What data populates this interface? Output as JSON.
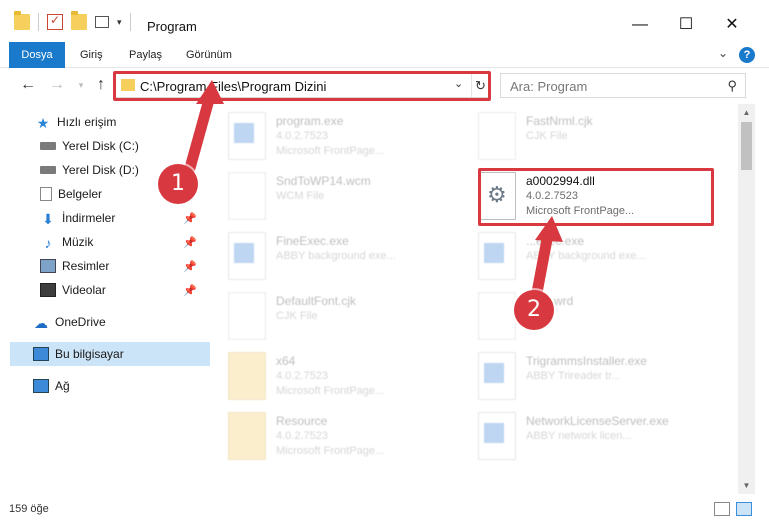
{
  "window": {
    "title": "Program",
    "controls": {
      "minimize": "—",
      "maximize": "☐",
      "close": "✕"
    }
  },
  "ribbon": {
    "tabs": [
      "Dosya",
      "Giriş",
      "Paylaş",
      "Görünüm"
    ],
    "expand_icon": "chevron-down-icon",
    "help_label": "?"
  },
  "nav": {
    "address": "C:\\Program Files\\Program Dizini",
    "search_placeholder": "Ara: Program",
    "back_glyph": "←",
    "forward_glyph": "→",
    "up_glyph": "↑",
    "refresh_glyph": "↻",
    "search_glyph": "⚲"
  },
  "sidebar": {
    "items": [
      {
        "label": "Hızlı erişim",
        "icon": "star-icon"
      },
      {
        "label": "Yerel Disk (C:)",
        "icon": "disk-icon"
      },
      {
        "label": "Yerel Disk (D:)",
        "icon": "disk-icon"
      },
      {
        "label": "Belgeler",
        "icon": "documents-icon"
      },
      {
        "label": "İndirmeler",
        "icon": "download-icon",
        "pinned": true
      },
      {
        "label": "Müzik",
        "icon": "music-icon",
        "pinned": true
      },
      {
        "label": "Resimler",
        "icon": "pictures-icon",
        "pinned": true
      },
      {
        "label": "Videolar",
        "icon": "video-icon",
        "pinned": true
      },
      {
        "label": "OneDrive",
        "icon": "cloud-icon"
      },
      {
        "label": "Bu bilgisayar",
        "icon": "computer-icon",
        "selected": true
      },
      {
        "label": "Ağ",
        "icon": "network-icon"
      }
    ]
  },
  "files": [
    {
      "name": "program.exe",
      "type": "4.0.2.7523",
      "desc": "Microsoft FrontPage...",
      "kind": "exe"
    },
    {
      "name": "FastNrml.cjk",
      "type": "CJK File",
      "desc": "",
      "kind": "page"
    },
    {
      "name": "SndToWP14.wcm",
      "type": "WCM File",
      "desc": "",
      "kind": "page"
    },
    {
      "name": "a0002994.dll",
      "type": "4.0.2.7523",
      "desc": "Microsoft FrontPage...",
      "kind": "dll"
    },
    {
      "name": "FineExec.exe",
      "type": "ABBY background exe...",
      "desc": "",
      "kind": "exe"
    },
    {
      "name": "...exec.exe",
      "type": "ABBY background exe...",
      "desc": "",
      "kind": "exe"
    },
    {
      "name": "DefaultFont.cjk",
      "type": "CJK File",
      "desc": "",
      "kind": "page"
    },
    {
      "name": "...sic.wrd",
      "type": "...File",
      "desc": "",
      "kind": "page"
    },
    {
      "name": "x64",
      "type": "4.0.2.7523",
      "desc": "Microsoft FrontPage...",
      "kind": "folder"
    },
    {
      "name": "TrigrammsInstaller.exe",
      "type": "ABBY Trireader tr...",
      "desc": "",
      "kind": "exe"
    },
    {
      "name": "Resource",
      "type": "4.0.2.7523",
      "desc": "Microsoft FrontPage...",
      "kind": "folder"
    },
    {
      "name": "NetworkLicenseServer.exe",
      "type": "ABBY network licen...",
      "desc": "",
      "kind": "exe"
    }
  ],
  "callouts": {
    "one": "1",
    "two": "2"
  },
  "status": {
    "count": "159 öğe"
  },
  "colors": {
    "accent": "#1979ca",
    "highlight": "#d8383f",
    "selection": "#cce4f7"
  }
}
